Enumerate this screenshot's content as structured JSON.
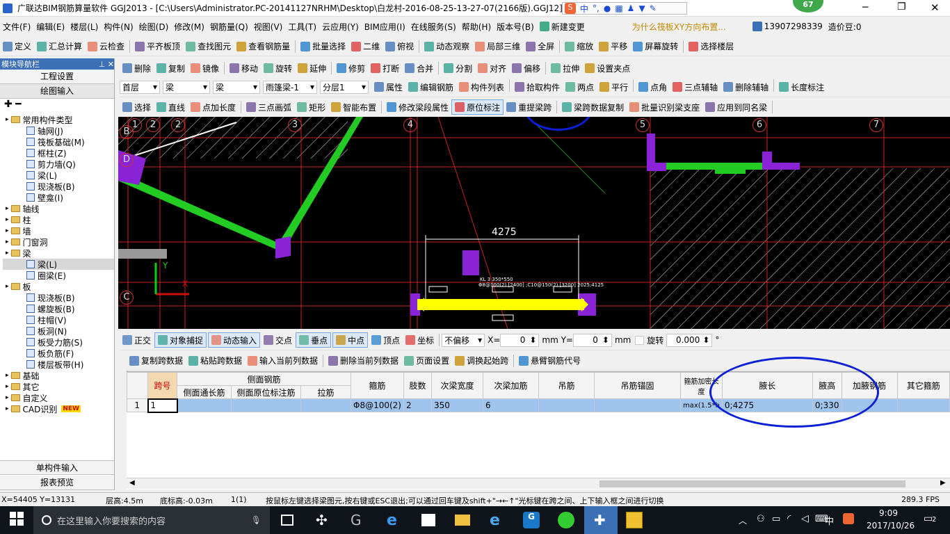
{
  "window": {
    "title": "广联达BIM钢筋算量软件 GGJ2013 - [C:\\Users\\Administrator.PC-20141127NRHM\\Desktop\\白龙村-2016-08-25-13-27-07(2166版).GGJ12]",
    "badge": "67"
  },
  "menu": {
    "items": [
      "文件(F)",
      "编辑(E)",
      "楼层(L)",
      "构件(N)",
      "绘图(D)",
      "修改(M)",
      "钢筋量(Q)",
      "视图(V)",
      "工具(T)",
      "云应用(Y)",
      "BIM应用(I)",
      "在线服务(S)",
      "帮助(H)",
      "版本号(B)"
    ],
    "new_change": "新建变更",
    "ad_text": "为什么筏板XY方向布置...",
    "phone": "13907298339",
    "price": "造价豆:0"
  },
  "toolbar1": [
    "定义",
    "汇总计算",
    "云检查",
    "平齐板顶",
    "查找图元",
    "查看钢筋量",
    "批量选择",
    "二维",
    "俯视",
    "动态观察",
    "局部三维",
    "全屏",
    "缩放",
    "平移",
    "屏幕旋转",
    "选择楼层"
  ],
  "toolbar2": [
    "删除",
    "复制",
    "镜像",
    "移动",
    "旋转",
    "延伸",
    "修剪",
    "打断",
    "合并",
    "分割",
    "对齐",
    "偏移",
    "拉伸",
    "设置夹点"
  ],
  "selectors": {
    "floor": "首层",
    "type1": "梁",
    "type2": "梁",
    "name": "雨篷梁-1",
    "layer": "分层1"
  },
  "toolbar3": [
    "属性",
    "编辑钢筋",
    "构件列表",
    "拾取构件",
    "两点",
    "平行",
    "点角",
    "三点辅轴",
    "删除辅轴",
    "长度标注"
  ],
  "toolbar4": [
    "选择",
    "直线",
    "点加长度",
    "三点画弧",
    "矩形",
    "智能布置",
    "修改梁段属性",
    "原位标注",
    "重提梁跨",
    "梁跨数据复制",
    "批量识别梁支座",
    "应用到同名梁"
  ],
  "nav": {
    "title": "模块导航栏",
    "btn_project": "工程设置",
    "btn_draw": "绘图输入",
    "tree": [
      {
        "label": "常用构件类型",
        "level": 0,
        "type": "folder"
      },
      {
        "label": "轴网(J)",
        "level": 1,
        "type": "leaf"
      },
      {
        "label": "筏板基础(M)",
        "level": 1,
        "type": "leaf"
      },
      {
        "label": "框柱(Z)",
        "level": 1,
        "type": "leaf"
      },
      {
        "label": "剪力墙(Q)",
        "level": 1,
        "type": "leaf"
      },
      {
        "label": "梁(L)",
        "level": 1,
        "type": "leaf"
      },
      {
        "label": "现浇板(B)",
        "level": 1,
        "type": "leaf"
      },
      {
        "label": "壁龛(I)",
        "level": 1,
        "type": "leaf"
      },
      {
        "label": "轴线",
        "level": 0,
        "type": "folder"
      },
      {
        "label": "柱",
        "level": 0,
        "type": "folder"
      },
      {
        "label": "墙",
        "level": 0,
        "type": "folder"
      },
      {
        "label": "门窗洞",
        "level": 0,
        "type": "folder"
      },
      {
        "label": "梁",
        "level": 0,
        "type": "folder"
      },
      {
        "label": "梁(L)",
        "level": 1,
        "type": "leaf"
      },
      {
        "label": "圈梁(E)",
        "level": 1,
        "type": "leaf"
      },
      {
        "label": "板",
        "level": 0,
        "type": "folder"
      },
      {
        "label": "现浇板(B)",
        "level": 1,
        "type": "leaf"
      },
      {
        "label": "螺旋板(B)",
        "level": 1,
        "type": "leaf"
      },
      {
        "label": "柱帽(V)",
        "level": 1,
        "type": "leaf"
      },
      {
        "label": "板洞(N)",
        "level": 1,
        "type": "leaf"
      },
      {
        "label": "板受力筋(S)",
        "level": 1,
        "type": "leaf"
      },
      {
        "label": "板负筋(F)",
        "level": 1,
        "type": "leaf"
      },
      {
        "label": "楼层板带(H)",
        "level": 1,
        "type": "leaf"
      },
      {
        "label": "基础",
        "level": 0,
        "type": "folder"
      },
      {
        "label": "其它",
        "level": 0,
        "type": "folder"
      },
      {
        "label": "自定义",
        "level": 0,
        "type": "folder"
      },
      {
        "label": "CAD识别",
        "level": 0,
        "type": "folder"
      }
    ],
    "new_badge": "NEW",
    "btn_single": "单构件输入",
    "btn_report": "报表预览"
  },
  "canvas": {
    "axis_top": [
      "1",
      "2",
      "2",
      "3",
      "4",
      "5",
      "6",
      "7"
    ],
    "axis_left": [
      "B",
      "D",
      "C"
    ],
    "dim": "4275",
    "beam_label": "KL 3 350*550",
    "beam_label2": "Φ8@100(2) [2400] ;C10@150(2) [3200] 2025;4125",
    "y_axis": "Y",
    "x_axis": "X"
  },
  "snapbar": {
    "items": [
      "正交",
      "对象捕捉",
      "动态输入",
      "交点",
      "垂点",
      "中点",
      "顶点",
      "坐标"
    ],
    "offset_mode": "不偏移",
    "x_label": "X=",
    "x_value": "0",
    "y_label": "mm Y=",
    "y_value": "0",
    "mm": "mm",
    "rotate": "旋转",
    "rotate_value": "0.000",
    "deg": "°"
  },
  "gridbar": [
    "复制跨数据",
    "粘贴跨数据",
    "输入当前列数据",
    "删除当前列数据",
    "页面设置",
    "调换起始跨",
    "悬臂钢筋代号"
  ],
  "table": {
    "group_header": "侧面钢筋",
    "headers": [
      "跨号",
      "侧面通长筋",
      "侧面原位标注筋",
      "拉筋",
      "箍筋",
      "肢数",
      "次梁宽度",
      "次梁加筋",
      "吊筋",
      "吊筋锚固",
      "箍筋加密长度",
      "腋长",
      "腋高",
      "加腋钢筋",
      "其它箍筋"
    ],
    "rows": [
      {
        "idx": "1",
        "cells": [
          "1",
          "",
          "",
          "",
          "Φ8@100(2)",
          "2",
          "350",
          "6",
          "",
          "",
          "max(1.5*h",
          "0;4275",
          "0;330",
          "",
          ""
        ]
      }
    ]
  },
  "status": {
    "coords": "X=54405 Y=13131",
    "floor_height": "层高:4.5m",
    "base_height": "底标高:-0.03m",
    "count": "1(1)",
    "hint": "按鼠标左键选择梁图元,按右键或ESC退出;可以通过回车键及shift+\"→←↑\"光标键在跨之间、上下输入框之间进行切换",
    "fps": "289.3 FPS"
  },
  "taskbar": {
    "search_placeholder": "在这里输入你要搜索的内容",
    "time": "9:09",
    "date": "2017/10/26",
    "ime": "中",
    "notif": "2"
  },
  "colors": {
    "accent": "#3b6fb6",
    "beam_green": "#22cc22",
    "column_purple": "#8a22d6",
    "beam_yellow": "#ffff00",
    "grid_red": "#cc2222",
    "annotation_blue": "#0a1fd6"
  }
}
